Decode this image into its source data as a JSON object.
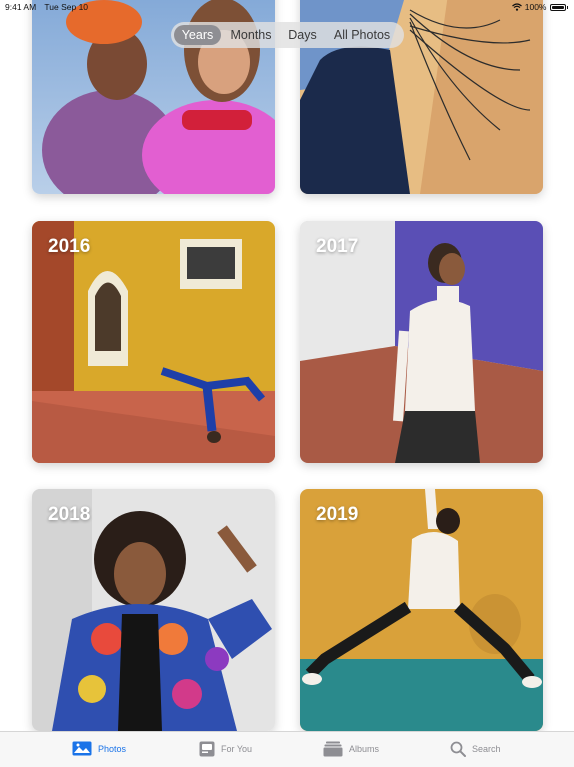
{
  "status": {
    "time": "9:41 AM",
    "date": "Tue Sep 10",
    "battery": "100%"
  },
  "segmented": {
    "items": [
      "Years",
      "Months",
      "Days",
      "All Photos"
    ],
    "selected": "Years"
  },
  "cards": [
    {
      "year": ""
    },
    {
      "year": ""
    },
    {
      "year": "2016"
    },
    {
      "year": "2017"
    },
    {
      "year": "2018"
    },
    {
      "year": "2019"
    }
  ],
  "tabs": [
    {
      "label": "Photos",
      "icon": "photos-icon",
      "active": true
    },
    {
      "label": "For You",
      "icon": "for-you-icon",
      "active": false
    },
    {
      "label": "Albums",
      "icon": "albums-icon",
      "active": false
    },
    {
      "label": "Search",
      "icon": "search-icon",
      "active": false
    }
  ],
  "colors": {
    "accent": "#1a73e8",
    "segment_selected": "#8e8e93"
  }
}
